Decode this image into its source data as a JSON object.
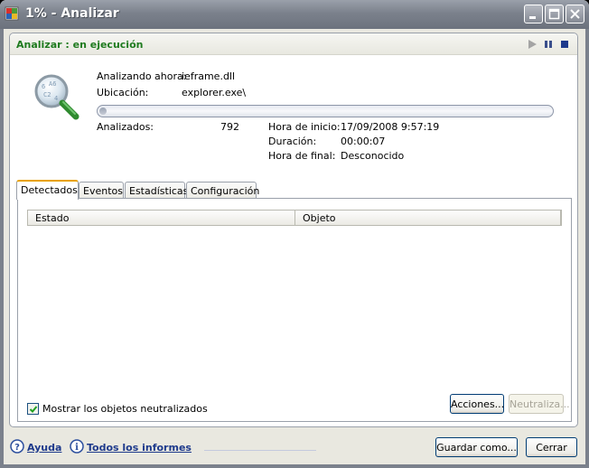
{
  "window": {
    "title": "1% - Analizar",
    "title_color": "#ffffff"
  },
  "panel": {
    "status_title": "Analizar : en ejecución",
    "status_color": "#1f7b1f",
    "controls": [
      "play-icon",
      "pause-icon",
      "stop-icon"
    ]
  },
  "scan": {
    "analyzing_label": "Analizando ahora:",
    "analyzing_value": "ieframe.dll",
    "location_label": "Ubicación:",
    "location_value": "explorer.exe\\",
    "progress_percent": 1,
    "analyzed_label": "Analizados:",
    "analyzed_value": "792",
    "start_label": "Hora de inicio:",
    "start_value": "17/09/2008 9:57:19",
    "duration_label": "Duración:",
    "duration_value": "00:00:07",
    "end_label": "Hora de final:",
    "end_value": "Desconocido"
  },
  "tabs": [
    {
      "label": "Detectados",
      "active": true
    },
    {
      "label": "Eventos",
      "active": false
    },
    {
      "label": "Estadísticas",
      "active": false
    },
    {
      "label": "Configuración",
      "active": false
    }
  ],
  "grid": {
    "columns": [
      "Estado",
      "Objeto"
    ],
    "rows": []
  },
  "options": {
    "show_neutralized_label": "Mostrar los objetos neutralizados",
    "show_neutralized_checked": true
  },
  "buttons": {
    "actions": "Acciones...",
    "neutralize": "Neutraliza...",
    "save_as": "Guardar como...",
    "close": "Cerrar"
  },
  "footer": {
    "help": "Ayuda",
    "all_reports": "Todos los informes"
  }
}
